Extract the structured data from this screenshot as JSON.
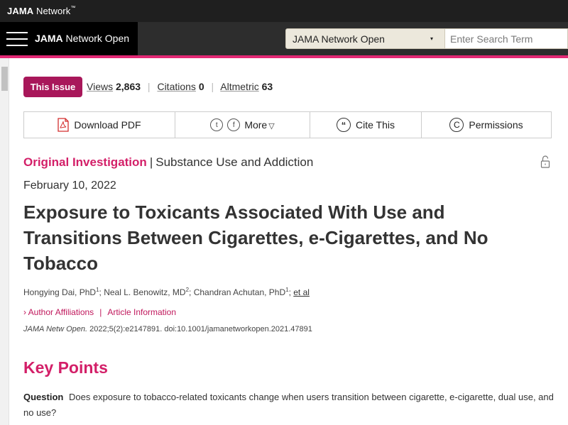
{
  "network": {
    "brand_bold": "JAMA",
    "brand_rest": " Network",
    "tm": "™"
  },
  "header": {
    "journal_bold": "JAMA",
    "journal_rest": " Network Open",
    "site_select_value": "JAMA Network Open",
    "site_select_caret": "▾",
    "search_placeholder": "Enter Search Term"
  },
  "metrics": {
    "issue_label": "This Issue",
    "views_label": "Views",
    "views_value": "2,863",
    "citations_label": "Citations",
    "citations_value": "0",
    "altmetric_label": "Altmetric",
    "altmetric_value": "63",
    "separator": "|"
  },
  "toolbar": {
    "download_pdf": "Download PDF",
    "twitter_glyph": "t",
    "facebook_glyph": "f",
    "more": "More",
    "more_caret": "▽",
    "cite_glyph": "“",
    "cite": "Cite This",
    "permissions_glyph": "C",
    "permissions": "Permissions"
  },
  "article": {
    "type": "Original Investigation",
    "type_separator": "|",
    "subject": "Substance Use and Addiction",
    "date": "February 10, 2022",
    "title": "Exposure to Toxicants Associated With Use and Transitions Between Cigarettes, e-Cigarettes, and No Tobacco",
    "authors": [
      {
        "name": "Hongying Dai, PhD",
        "sup": "1"
      },
      {
        "name": "Neal L. Benowitz, MD",
        "sup": "2"
      },
      {
        "name": "Chandran Achutan, PhD",
        "sup": "1"
      }
    ],
    "author_separator": "; ",
    "et_al": "et al",
    "affiliations_link": "Author Affiliations",
    "affiliations_prefix": "›",
    "aff_separator": "|",
    "article_info_link": "Article Information",
    "citation_journal": "JAMA Netw Open.",
    "citation_rest": " 2022;5(2):e2147891. doi:10.1001/jamanetworkopen.2021.47891"
  },
  "key_points": {
    "heading": "Key Points",
    "question_label": "Question",
    "question_text": "Does exposure to tobacco-related toxicants change when users transition between cigarette, e-cigarette, dual use, and no use?"
  },
  "colors": {
    "accent_pink": "#e22874",
    "badge_magenta": "#a8175a",
    "link_pink": "#d31f68",
    "header_dark": "#2d2d2d"
  }
}
